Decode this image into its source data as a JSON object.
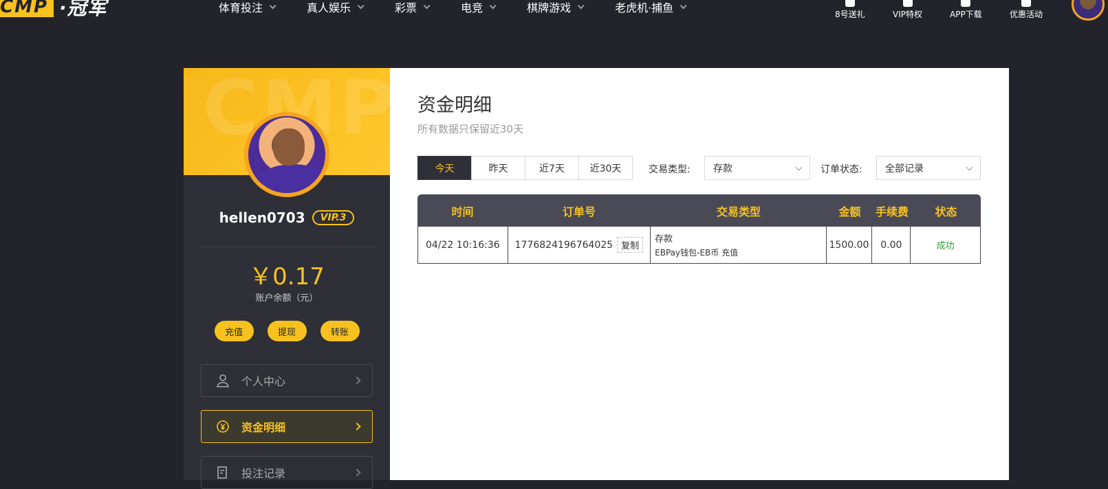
{
  "header": {
    "logo_box": "CMP",
    "logo_text": "·冠军",
    "menu": [
      {
        "label": "体育投注"
      },
      {
        "label": "真人娱乐"
      },
      {
        "label": "彩票"
      },
      {
        "label": "电竞"
      },
      {
        "label": "棋牌游戏"
      },
      {
        "label": "老虎机·捕鱼"
      }
    ],
    "quick_links": [
      {
        "label": "8号送礼",
        "icon": "gift-icon"
      },
      {
        "label": "VIP特权",
        "icon": "vip-icon"
      },
      {
        "label": "APP下载",
        "icon": "phone-icon"
      },
      {
        "label": "优惠活动",
        "icon": "promo-icon"
      }
    ]
  },
  "sidebar": {
    "watermark": "CMP",
    "username": "hellen0703",
    "vip": "VIP.3",
    "balance": "￥0.17",
    "balance_label": "账户余额（元）",
    "actions": [
      {
        "label": "充值"
      },
      {
        "label": "提现"
      },
      {
        "label": "转账"
      }
    ],
    "nav": [
      {
        "label": "个人中心",
        "icon": "user-icon"
      },
      {
        "label": "资金明细",
        "icon": "yuan-icon",
        "active": true
      },
      {
        "label": "投注记录",
        "icon": "record-icon"
      }
    ]
  },
  "main": {
    "title": "资金明细",
    "subtitle": "所有数据只保留近30天",
    "ranges": [
      {
        "label": "今天",
        "active": true
      },
      {
        "label": "昨天"
      },
      {
        "label": "近7天"
      },
      {
        "label": "近30天"
      }
    ],
    "filter_type_label": "交易类型:",
    "filter_type_value": "存款",
    "filter_status_label": "订单状态:",
    "filter_status_value": "全部记录",
    "table": {
      "headers": [
        "时间",
        "订单号",
        "交易类型",
        "金额",
        "手续费",
        "状态"
      ],
      "rows": [
        {
          "time": "04/22 10:16:36",
          "order_no": "1776824196764025",
          "copy_label": "复制",
          "type_main": "存款",
          "type_detail": "EBPay钱包-EB币 充值",
          "amount": "1500.00",
          "fee": "0.00",
          "status": "成功"
        }
      ]
    }
  },
  "colors": {
    "accent": "#f7c21f",
    "dark": "#23232b",
    "panel": "#2f2f37",
    "success": "#2a9d2a"
  }
}
